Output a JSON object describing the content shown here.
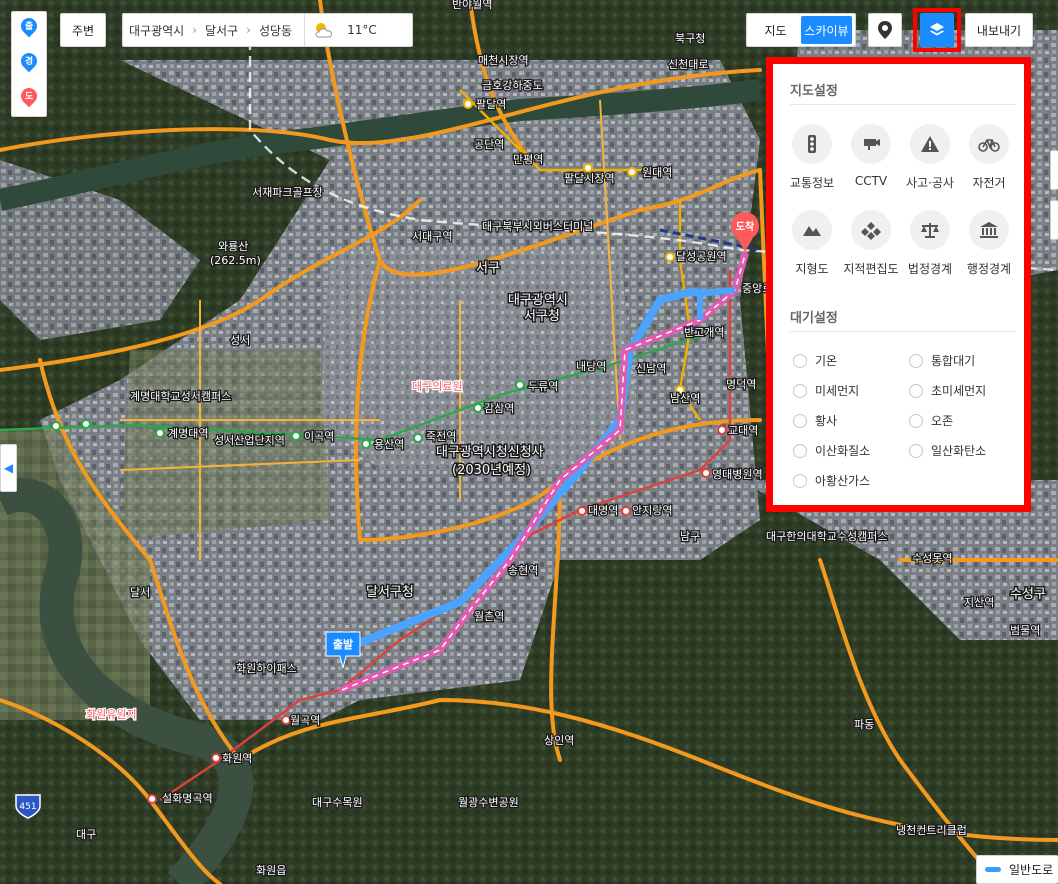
{
  "route_buttons": [
    {
      "label": "출",
      "color": "#1a8cff"
    },
    {
      "label": "경",
      "color": "#1a8cff"
    },
    {
      "label": "도",
      "color": "#ff5a5a"
    }
  ],
  "nearby_label": "주변",
  "breadcrumb": {
    "city": "대구광역시",
    "district": "달서구",
    "dong": "성당동",
    "temperature": "11°C"
  },
  "map_type": {
    "map_label": "지도",
    "sky_label": "스카이뷰",
    "selected": "스카이뷰"
  },
  "export_label": "내보내기",
  "panel": {
    "map_settings_title": "지도설정",
    "map_settings": [
      {
        "label": "교통정보",
        "icon": "traffic-light-icon"
      },
      {
        "label": "CCTV",
        "icon": "cctv-icon"
      },
      {
        "label": "사고·공사",
        "icon": "warning-icon"
      },
      {
        "label": "자전거",
        "icon": "bicycle-icon"
      },
      {
        "label": "지형도",
        "icon": "mountain-icon"
      },
      {
        "label": "지적편집도",
        "icon": "cadastral-icon"
      },
      {
        "label": "법정경계",
        "icon": "scale-icon"
      },
      {
        "label": "행정경계",
        "icon": "government-building-icon"
      }
    ],
    "air_title": "대기설정",
    "air_options": [
      "기온",
      "통합대기",
      "미세먼지",
      "초미세먼지",
      "황사",
      "오존",
      "이산화질소",
      "일산화탄소",
      "아황산가스"
    ]
  },
  "markers": {
    "start": "출발",
    "end": "도착"
  },
  "legend_label": "일반도로",
  "highway_shield": "451",
  "colors": {
    "accent": "#1a8cff",
    "highlight": "#ff0000",
    "route_blue": "#4aa3ff",
    "route_pink": "#e05cb0",
    "end_marker": "#ff5a5a"
  },
  "map_labels": {
    "a": "반야월역",
    "b": "북구청",
    "c": "매천시장역",
    "d": "팔달역",
    "e": "금호강하중도",
    "f": "공단역",
    "g": "만평역",
    "h": "팔달시장역",
    "i": "원대역",
    "j": "서재파크골프장",
    "k": "와룡산",
    "l": "(262.5m)",
    "m": "대구북부시외버스터미널",
    "n": "서대구역",
    "o": "서구",
    "p": "대구광역시",
    "q": "서구청",
    "r": "달성공원역",
    "s": "중앙로",
    "t": "반고개역",
    "u": "두류역",
    "v": "내당역",
    "w": "신남역",
    "x": "명덕역",
    "y": "대구의료원",
    "z": "감삼역",
    "aa": "계명대학교성서캠퍼스",
    "ab": "계명대역",
    "ac": "성서산업단지역",
    "ad": "이곡역",
    "ae": "용산역",
    "af": "죽전역",
    "ag": "대구광역시청신청사",
    "ah": "(2030년예정)",
    "ai": "교대역",
    "aj": "영대병원역",
    "ak": "대명역",
    "al": "안지랑역",
    "am": "남구",
    "an": "달서구청",
    "ao": "송현역",
    "ap": "월촌역",
    "aq": "상인역",
    "ar": "월곡역",
    "as": "화원역",
    "at": "설화명곡역",
    "au": "대구수목원",
    "av": "월광수변공원",
    "aw": "화원유원지",
    "ax": "달서",
    "ay": "성서",
    "az": "대구한의대학교수성캠퍼스",
    "ba": "수성못역",
    "bb": "지산역",
    "bc": "범물역",
    "bd": "파동",
    "be": "냉천컨트리클럽",
    "bf": "화원읍",
    "bg": "대구",
    "bh": "수성구",
    "bi": "이천역",
    "bj": "신천대로",
    "bk": "남산역",
    "bl": "화원하이패스"
  }
}
